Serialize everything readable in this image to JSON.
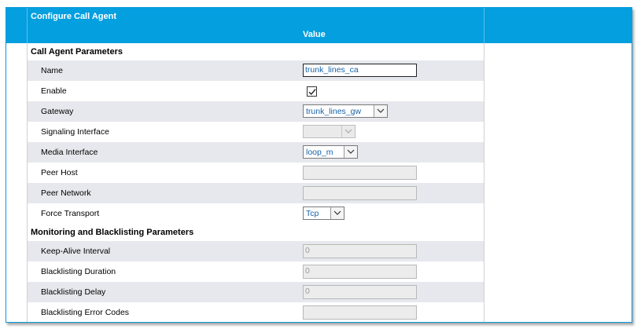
{
  "header": {
    "title": "Configure Call Agent",
    "value_column": "Value"
  },
  "sections": {
    "call_agent": "Call Agent Parameters",
    "monitoring": "Monitoring and Blacklisting Parameters"
  },
  "fields": {
    "name": {
      "label": "Name",
      "value": "trunk_lines_ca"
    },
    "enable": {
      "label": "Enable",
      "checked": true
    },
    "gateway": {
      "label": "Gateway",
      "value": "trunk_lines_gw"
    },
    "signaling_interface": {
      "label": "Signaling Interface",
      "value": ""
    },
    "media_interface": {
      "label": "Media Interface",
      "value": "loop_m"
    },
    "peer_host": {
      "label": "Peer Host",
      "value": ""
    },
    "peer_network": {
      "label": "Peer Network",
      "value": ""
    },
    "force_transport": {
      "label": "Force Transport",
      "value": "Tcp"
    },
    "keep_alive_interval": {
      "label": "Keep-Alive Interval",
      "value": "0"
    },
    "blacklisting_duration": {
      "label": "Blacklisting Duration",
      "value": "0"
    },
    "blacklisting_delay": {
      "label": "Blacklisting Delay",
      "value": "0"
    },
    "blacklisting_error_codes": {
      "label": "Blacklisting Error Codes",
      "value": ""
    }
  },
  "colors": {
    "header_bg": "#049fdf",
    "row_alt": "#e7e8ed",
    "value_text": "#1561a8"
  },
  "icons": {
    "checkmark": "check-icon",
    "dropdown": "chevron-down-icon"
  }
}
